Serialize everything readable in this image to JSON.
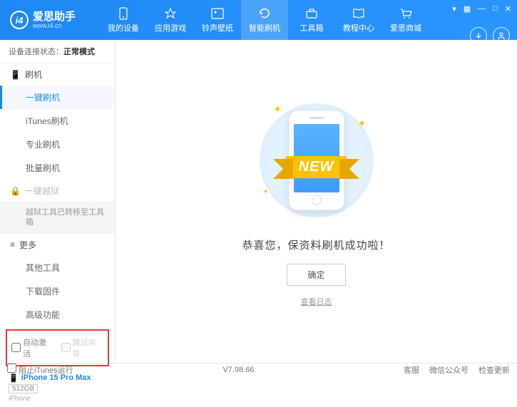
{
  "header": {
    "app_name": "爱思助手",
    "app_url": "www.i4.cn",
    "nav": [
      {
        "label": "我的设备"
      },
      {
        "label": "应用游戏"
      },
      {
        "label": "铃声壁纸"
      },
      {
        "label": "智能刷机"
      },
      {
        "label": "工具箱"
      },
      {
        "label": "教程中心"
      },
      {
        "label": "爱思商城"
      }
    ]
  },
  "sidebar": {
    "conn_prefix": "设备连接状态：",
    "conn_status": "正常模式",
    "flash_header": "刷机",
    "flash_items": [
      "一键刷机",
      "iTunes刷机",
      "专业刷机",
      "批量刷机"
    ],
    "jailbreak_header": "一键越狱",
    "jailbreak_note": "越狱工具已转移至工具箱",
    "more_header": "更多",
    "more_items": [
      "其他工具",
      "下载固件",
      "高级功能"
    ],
    "checkbox1": "自动激活",
    "checkbox2": "跳过向导",
    "device": {
      "name": "iPhone 15 Pro Max",
      "storage": "512GB",
      "type": "iPhone"
    }
  },
  "main": {
    "ribbon": "NEW",
    "success": "恭喜您，保资料刷机成功啦！",
    "ok": "确定",
    "log": "查看日志"
  },
  "footer": {
    "block_itunes": "阻止iTunes运行",
    "version": "V7.98.66",
    "items": [
      "客服",
      "微信公众号",
      "检查更新"
    ]
  }
}
